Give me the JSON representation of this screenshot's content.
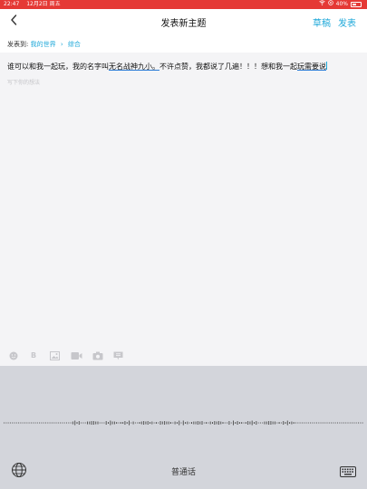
{
  "status_bar": {
    "time": "22:47",
    "date": "12月2日 周五",
    "battery": "40%"
  },
  "nav": {
    "back_icon": "chevron-left-icon",
    "title": "发表新主题",
    "draft_label": "草稿",
    "publish_label": "发表"
  },
  "post_to": {
    "label": "发表到:",
    "board": "我的世界",
    "category": "综合"
  },
  "editor": {
    "content_before": "谁可以和我一起玩，我的名字叫",
    "content_name": "无名战神九小。",
    "content_mid": "不许点赞，我都说了几遍！！！想和我一起",
    "content_tail": "玩需要说",
    "placeholder": "写下你的想法"
  },
  "toolbar": {
    "tools": [
      "emoji-icon",
      "bold-icon",
      "image-icon",
      "video-icon",
      "camera-icon",
      "comment-icon"
    ]
  },
  "keyboard": {
    "language": "普通话",
    "globe_icon": "globe-icon",
    "keyboard_icon": "keyboard-icon"
  },
  "colors": {
    "status_bar": "#e53935",
    "accent": "#1ea8d9",
    "keyboard_bg": "#d3d5db"
  }
}
